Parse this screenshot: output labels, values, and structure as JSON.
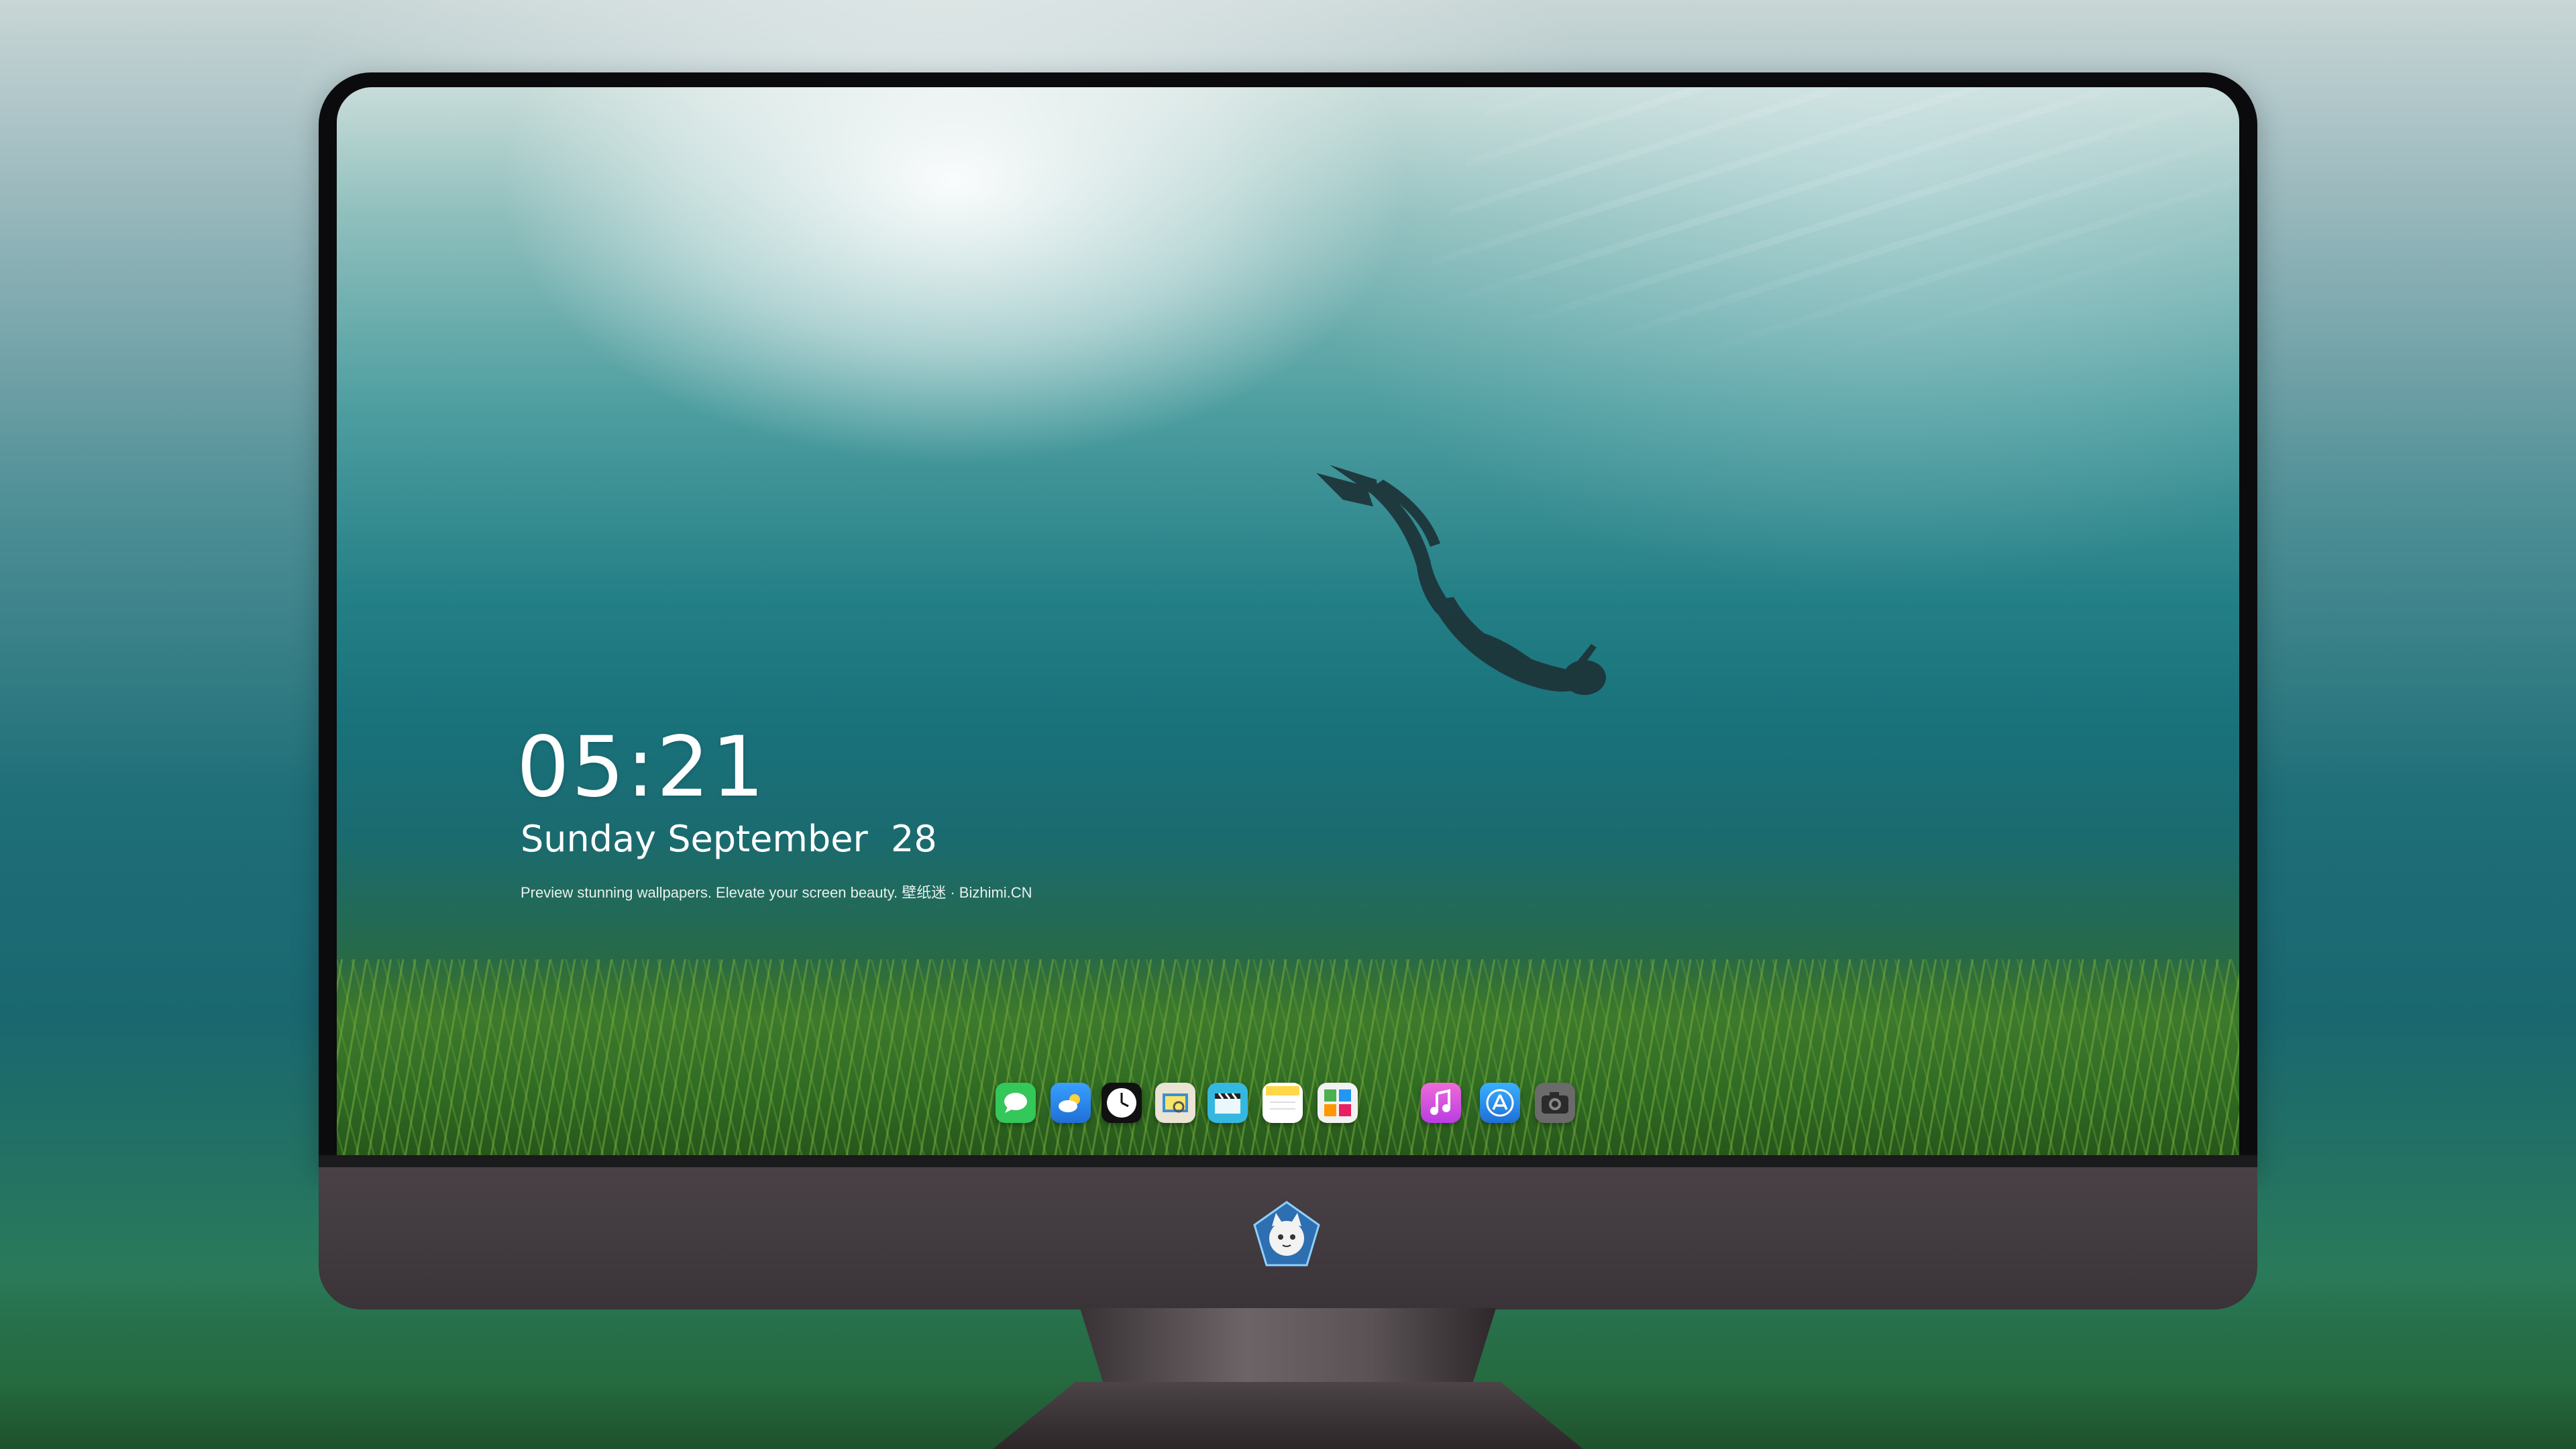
{
  "lockscreen": {
    "time": "05:21",
    "date": "Sunday September  28",
    "caption": "Preview stunning wallpapers. Elevate your screen beauty. 壁纸迷 · Bizhimi.CN"
  },
  "dock": {
    "apps": [
      {
        "name": "messages-icon",
        "color": "#34c759"
      },
      {
        "name": "weather-icon",
        "color": "#2f8cf0"
      },
      {
        "name": "clock-icon",
        "color": "#111111"
      },
      {
        "name": "preview-icon",
        "color": "#e9e4d4"
      },
      {
        "name": "clips-icon",
        "color": "#35b8e0"
      },
      {
        "name": "notes-icon",
        "color": "#ffd84a"
      },
      {
        "name": "photo-editor-icon",
        "color": "#f2f2f2"
      },
      {
        "name": "itunes-icon",
        "color": "#e84ad1"
      },
      {
        "name": "app-store-icon",
        "color": "#1f8fe6"
      },
      {
        "name": "camera-icon",
        "color": "#6b6b6b"
      }
    ]
  },
  "monitor": {
    "chin_logo": "cat-mascot-logo"
  }
}
